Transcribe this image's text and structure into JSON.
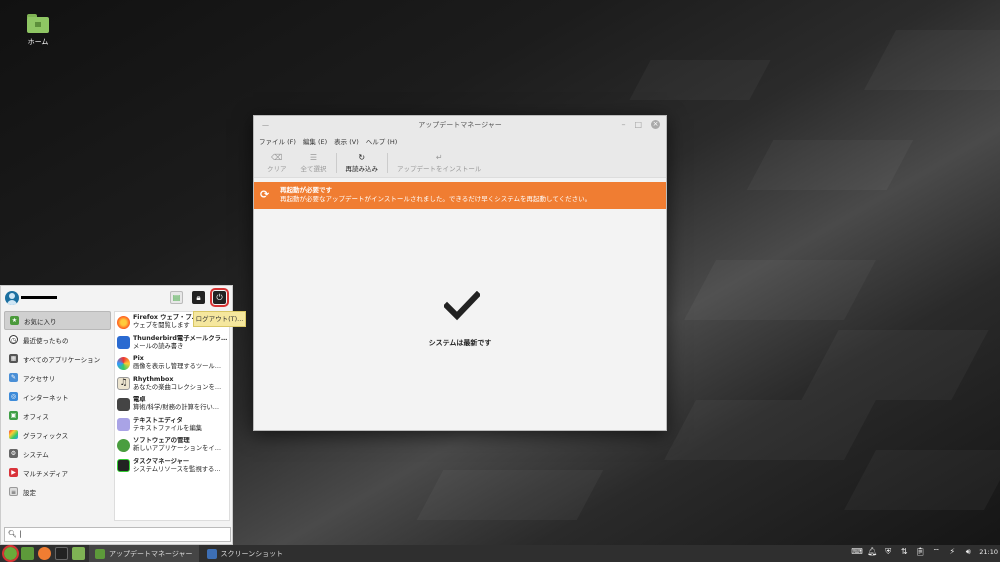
{
  "desktop": {
    "home_label": "ホーム"
  },
  "window": {
    "title": "アップデートマネージャー",
    "menu": [
      "ファイル (F)",
      "編集 (E)",
      "表示 (V)",
      "ヘルプ (H)"
    ],
    "toolbar": {
      "clear": "クリア",
      "select_all": "全て選択",
      "reload": "再読み込み",
      "install": "アップデートをインストール"
    },
    "banner": {
      "title": "再起動が必要です",
      "message": "再起動が必要なアップデートがインストールされました。できるだけ早くシステムを再起動してください。"
    },
    "status": "システムは最新です"
  },
  "menu": {
    "categories": [
      "お気に入り",
      "最近使ったもの",
      "すべてのアプリケーション",
      "アクセサリ",
      "インターネット",
      "オフィス",
      "グラフィックス",
      "システム",
      "マルチメディア",
      "設定"
    ],
    "apps": [
      {
        "name": "Firefox ウェブ・ブ…",
        "desc": "ウェブを閲覧します"
      },
      {
        "name": "Thunderbird電子メールクラ…",
        "desc": "メールの読み書き"
      },
      {
        "name": "Pix",
        "desc": "画像を表示し管理するツール…"
      },
      {
        "name": "Rhythmbox",
        "desc": "あなたの楽曲コレクションを…"
      },
      {
        "name": "電卓",
        "desc": "算術/科学/財務の計算を行い…"
      },
      {
        "name": "テキストエディタ",
        "desc": "テキストファイルを編集"
      },
      {
        "name": "ソフトウェアの管理",
        "desc": "新しいアプリケーションをイ…"
      },
      {
        "name": "タスクマネージャー",
        "desc": "システムリソースを監視する…"
      }
    ],
    "tooltip": "ログアウト(T)...",
    "search_value": "|"
  },
  "taskbar": {
    "task1": "アップデートマネージャー",
    "task2": "スクリーンショット",
    "clock": "21:10"
  },
  "colors": {
    "accent": "#f07d32",
    "highlight": "#d63333"
  }
}
